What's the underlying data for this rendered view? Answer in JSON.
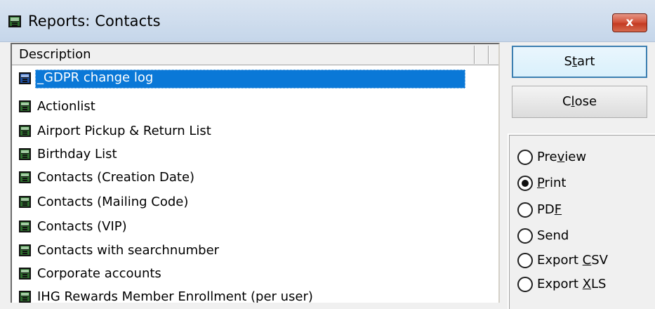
{
  "window": {
    "title": "Reports: Contacts",
    "close_glyph": "x",
    "icon": "report-book-icon"
  },
  "list": {
    "column_header": "Description",
    "items": [
      {
        "label": "_GDPR change log",
        "selected": true
      },
      {
        "label": "Actionlist",
        "selected": false
      },
      {
        "label": "Airport Pickup & Return List",
        "selected": false
      },
      {
        "label": "Birthday List",
        "selected": false
      },
      {
        "label": "Contacts (Creation Date)",
        "selected": false
      },
      {
        "label": "Contacts (Mailing Code)",
        "selected": false
      },
      {
        "label": "Contacts (VIP)",
        "selected": false
      },
      {
        "label": "Contacts with searchnumber",
        "selected": false
      },
      {
        "label": "Corporate accounts",
        "selected": false
      },
      {
        "label": "IHG Rewards Member Enrollment (per user)",
        "selected": false
      }
    ],
    "item_icon": "report-book-icon"
  },
  "buttons": {
    "start": {
      "pre": "S",
      "key": "t",
      "post": "art"
    },
    "close": {
      "pre": "C",
      "key": "l",
      "post": "ose"
    }
  },
  "output_options": {
    "selected": "Print",
    "items": [
      {
        "label": "Preview",
        "pre": "Pre",
        "key": "v",
        "post": "iew",
        "checked": false
      },
      {
        "label": "Print",
        "pre": "",
        "key": "P",
        "post": "rint",
        "checked": true
      },
      {
        "label": "PDF",
        "pre": "PD",
        "key": "F",
        "post": "",
        "checked": false
      },
      {
        "label": "Send",
        "pre": "Send",
        "key": "",
        "post": "",
        "checked": false
      },
      {
        "label": "Export CSV",
        "pre": "Export ",
        "key": "C",
        "post": "SV",
        "checked": false
      },
      {
        "label": "Export XLS",
        "pre": "Export ",
        "key": "X",
        "post": "LS",
        "checked": false
      }
    ]
  }
}
